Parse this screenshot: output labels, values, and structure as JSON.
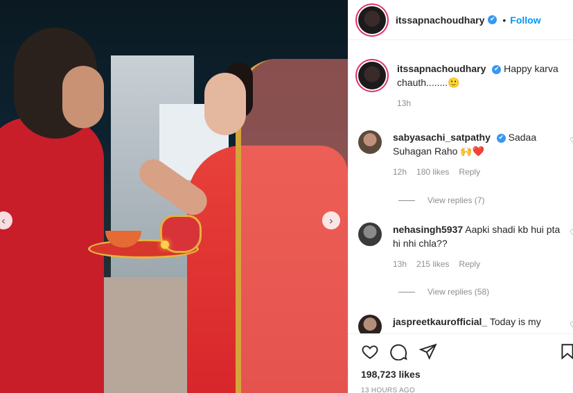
{
  "post": {
    "author": "itssapnachoudhary",
    "follow_label": "Follow",
    "separator": "•",
    "caption_text": "Happy karva chauth........🙂",
    "caption_time": "13h",
    "likes": "198,723 likes",
    "timestamp": "13 HOURS AGO"
  },
  "comments": [
    {
      "user": "sabyasachi_satpathy",
      "verified": true,
      "text": "Sadaa Suhagan Raho 🙌❤️",
      "time": "12h",
      "likes": "180 likes",
      "reply_label": "Reply",
      "view_replies": "View replies (7)"
    },
    {
      "user": "nehasingh5937",
      "verified": false,
      "text": "Aapki shadi kb hui pta hi nhi chla??",
      "time": "13h",
      "likes": "215 likes",
      "reply_label": "Reply",
      "view_replies": "View replies (58)"
    },
    {
      "user": "jaspreetkaurofficial_",
      "verified": false,
      "text": "Today is my"
    }
  ],
  "icons": {
    "verified": "✔",
    "heart": "heart-icon",
    "comment": "comment-icon",
    "share": "share-icon",
    "bookmark": "bookmark-icon",
    "prev": "‹",
    "next": "›"
  },
  "colors": {
    "link": "#0095f6",
    "verified": "#3897f0",
    "muted": "#8e8e8e"
  }
}
